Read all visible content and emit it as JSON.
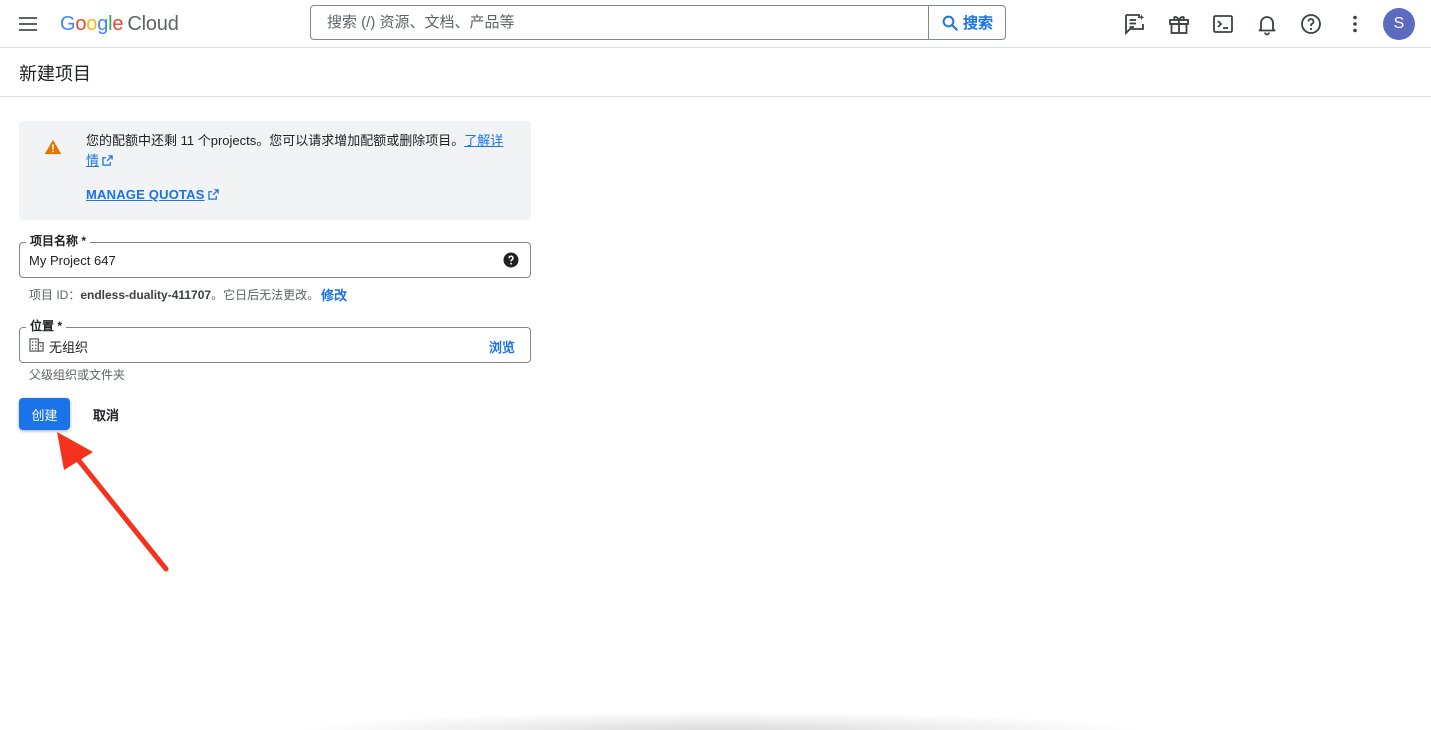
{
  "header": {
    "logo_google": "Google",
    "logo_cloud": "Cloud",
    "search_placeholder": "搜索 (/) 资源、文档、产品等",
    "search_button": "搜索",
    "avatar_letter": "S",
    "icons": [
      "menu-icon",
      "feedback-icon",
      "gift-icon",
      "cloud-shell-icon",
      "notifications-icon",
      "help-icon",
      "more-vert-icon"
    ]
  },
  "page": {
    "title": "新建项目"
  },
  "quota": {
    "text": "您的配额中还剩 11 个projects。您可以请求增加配额或删除项目。",
    "learn_more": "了解详情",
    "manage_quotas": "MANAGE QUOTAS",
    "icon": "warning-icon",
    "warning_color": "#e37400"
  },
  "project_name": {
    "label": "项目名称 *",
    "value": "My Project 647"
  },
  "project_id": {
    "prefix": "项目 ID：",
    "id": "endless-duality-411707",
    "suffix": "。它日后无法更改。",
    "edit_label": "修改"
  },
  "location": {
    "label": "位置 *",
    "value": "无组织",
    "browse_label": "浏览",
    "hint": "父级组织或文件夹"
  },
  "actions": {
    "create_label": "创建",
    "cancel_label": "取消"
  },
  "colors": {
    "accent": "#1a73e8",
    "annotation_arrow": "#f5321e"
  }
}
